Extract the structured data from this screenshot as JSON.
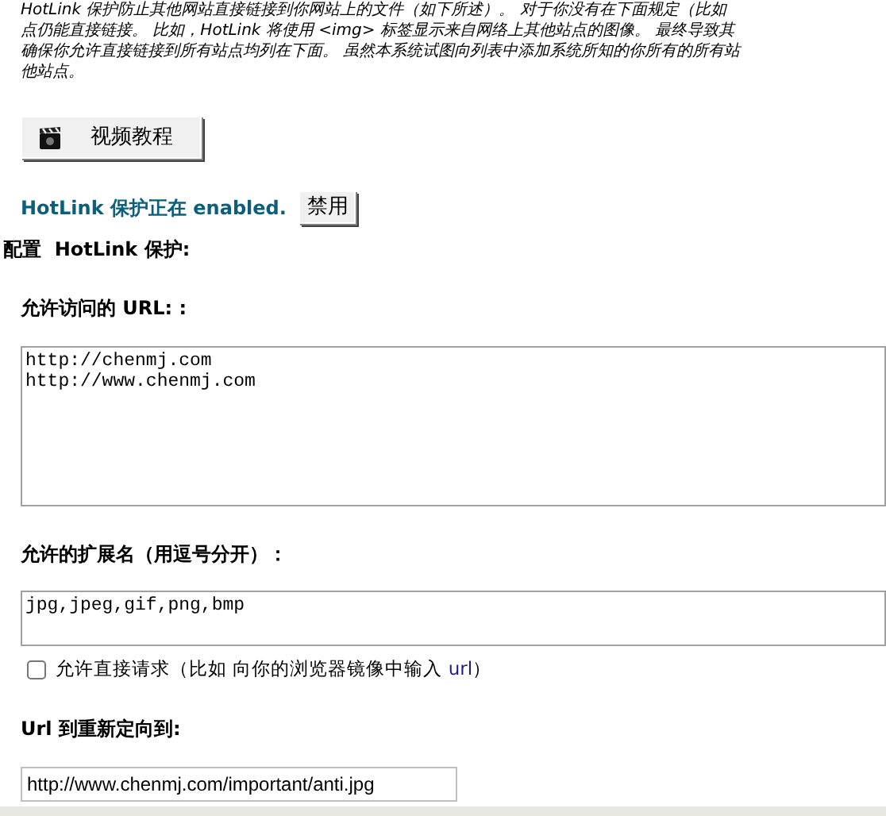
{
  "intro_lines": [
    "HotLink 保护防止其他网站直接链接到你网站上的文件（如下所述）。 对于你没有在下面规定（比如",
    "点仍能直接链接。 比如，HotLink 将使用 <img> 标签显示来自网络上其他站点的图像。 最终导致其",
    "确保你允许直接链接到所有站点均列在下面。 虽然本系统试图向列表中添加系统所知的你所有的所有站",
    "他站点。"
  ],
  "video_button": {
    "label": "视频教程"
  },
  "status": {
    "text": "HotLink 保护正在 enabled.",
    "button": "禁用"
  },
  "section_title": "配置  HotLink 保护:",
  "allowed_urls": {
    "label": "允许访问的 URL: :",
    "value": "http://chenmj.com\nhttp://www.chenmj.com"
  },
  "extensions": {
    "label": "允许的扩展名（用逗号分开）：",
    "value": "jpg,jpeg,gif,png,bmp"
  },
  "allow_direct": {
    "label": "允许直接请求（比如 向你的浏览器镜像中输入",
    "link": "url",
    "after": "）",
    "checked": false
  },
  "redirect": {
    "label": "Url 到重新定向到:",
    "value": "http://www.chenmj.com/important/anti.jpg"
  }
}
